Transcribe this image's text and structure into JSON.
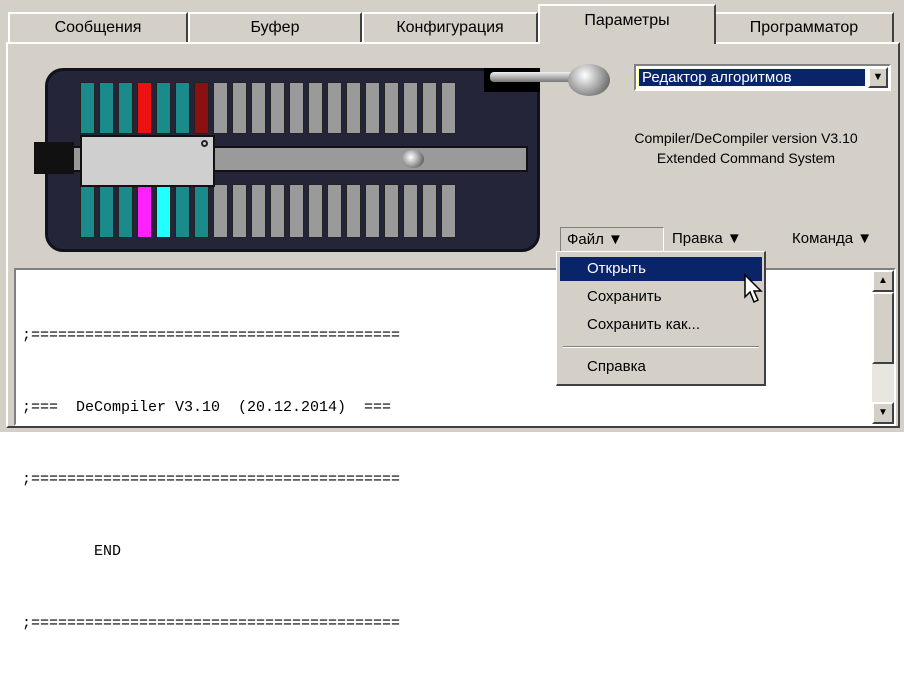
{
  "tabs": [
    {
      "label": "Сообщения"
    },
    {
      "label": "Буфер"
    },
    {
      "label": "Конфигурация"
    },
    {
      "label": "Параметры"
    },
    {
      "label": "Программатор"
    }
  ],
  "active_tab": "Параметры",
  "algorithm_select": {
    "value": "Редактор алгоритмов"
  },
  "info": {
    "line1": "Compiler/DeCompiler version V3.10",
    "line2": "Extended Command System"
  },
  "menubar": {
    "file": "Файл ▼",
    "edit": "Правка ▼",
    "command": "Команда ▼"
  },
  "file_menu": {
    "open": "Открыть",
    "save": "Сохранить",
    "save_as": "Сохранить как...",
    "help": "Справка"
  },
  "editor": {
    "lines": [
      ";=========================================",
      ";===  DeCompiler V3.10  (20.12.2014)  ===",
      ";=========================================",
      "        END",
      ";========================================="
    ]
  },
  "colors": {
    "window_bg": "#d4d0c8",
    "selection": "#0a246a",
    "pin_teal": "#1a8a8a",
    "pin_red": "#ee1111",
    "pin_darkred": "#8a1111",
    "pin_magenta": "#ff22ff",
    "pin_cyan": "#22ffff",
    "pin_grey": "#9a9a9a"
  },
  "icons": {
    "combo_arrow": "chevron-down-icon",
    "scroll_up": "arrow-up-icon",
    "scroll_down": "arrow-down-icon",
    "cursor": "mouse-pointer-icon"
  }
}
